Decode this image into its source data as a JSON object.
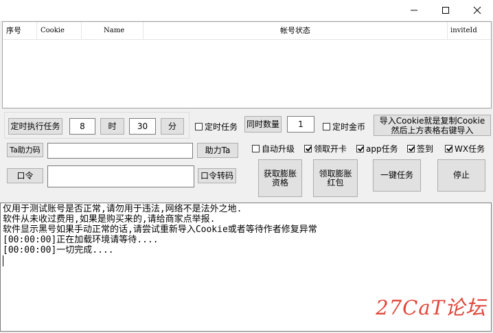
{
  "window": {
    "controls": {
      "minimize": "minimize-icon",
      "maximize": "maximize-icon",
      "close": "close-icon"
    }
  },
  "grid": {
    "columns": [
      "序号",
      "Cookie",
      "Name",
      "帐号状态",
      "inviteId"
    ]
  },
  "schedule": {
    "run_button": "定时执行任务",
    "hour_value": "8",
    "hour_label": "时",
    "minute_value": "30",
    "minute_label": "分"
  },
  "options": {
    "timed_task": "定时任务",
    "concurrency_button": "同时数量",
    "concurrency_value": "1",
    "timed_coin": "定时金币",
    "import_button_line1": "导入Cookie就是复制Cookie",
    "import_button_line2": "然后上方表格右键导入"
  },
  "help": {
    "help_ta_button": "Ta助力码",
    "help_input": "",
    "assist_button": "助力Ta"
  },
  "checkboxes": [
    {
      "label": "自动升级",
      "checked": false
    },
    {
      "label": "领取开卡",
      "checked": true
    },
    {
      "label": "app任务",
      "checked": true
    },
    {
      "label": "签到",
      "checked": true
    },
    {
      "label": "WX任务",
      "checked": true
    }
  ],
  "command": {
    "command_button": "口令",
    "command_input": "",
    "convert_button": "口令转码"
  },
  "actions": {
    "get_qualification": "获取膨胀资格",
    "claim_red_packet": "领取膨胀红包",
    "one_click": "一键任务",
    "stop": "停止"
  },
  "log_lines": [
    "仅用于测试账号是否正常,请勿用于违法,网络不是法外之地.",
    "软件从未收过费用,如果是购买来的,请给商家点举报.",
    "软件显示黑号如果手动正常的话,请尝试重新导入Cookie或者等待作者修复异常",
    "[00:00:00]正在加载环境请等待....",
    "[00:00:00]一切完成...."
  ],
  "watermark": "27CaT论坛",
  "colors": {
    "watermark": "#e0463a",
    "button_bg": "#e1e1e1",
    "window_bg": "#f0f0f0"
  }
}
